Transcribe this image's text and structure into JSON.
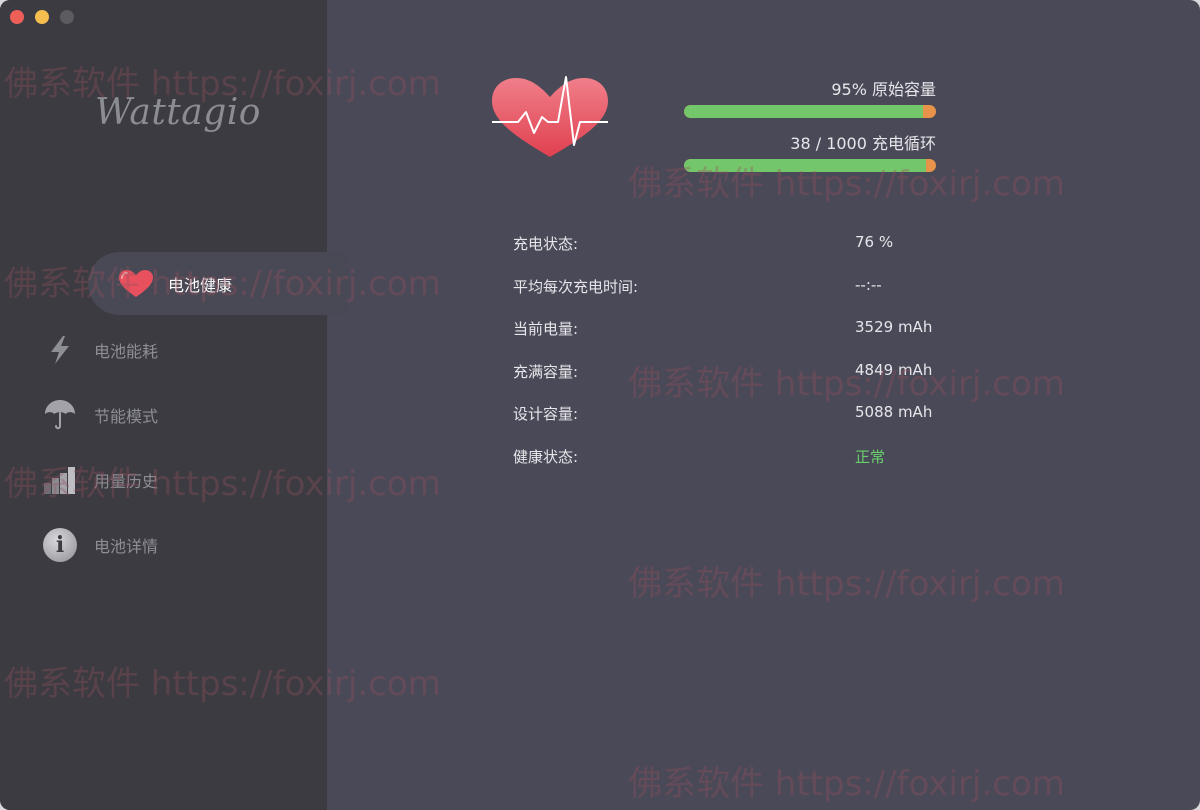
{
  "app": {
    "logo_text": "Wattagio"
  },
  "sidebar": {
    "items": [
      {
        "label": "电池健康",
        "icon": "heart-icon",
        "active": true
      },
      {
        "label": "电池能耗",
        "icon": "lightning-icon",
        "active": false
      },
      {
        "label": "节能模式",
        "icon": "umbrella-icon",
        "active": false
      },
      {
        "label": "用量历史",
        "icon": "bar-chart-icon",
        "active": false
      },
      {
        "label": "电池详情",
        "icon": "info-icon",
        "active": false
      }
    ],
    "info_glyph": "i"
  },
  "health": {
    "capacity_label": "95%  原始容量",
    "capacity_fraction": 0.95,
    "cycles_label": "38 / 1000 充电循环",
    "cycles_fraction": 0.96
  },
  "details": [
    {
      "key": "充电状态:",
      "value": "76 %"
    },
    {
      "key": "平均每次充电时间:",
      "value": "--:--"
    },
    {
      "key": "当前电量:",
      "value": "3529 mAh"
    },
    {
      "key": "充满容量:",
      "value": "4849 mAh"
    },
    {
      "key": "设计容量:",
      "value": "5088 mAh"
    },
    {
      "key": "健康状态:",
      "value": "正常"
    }
  ],
  "watermark": "佛系软件 https://foxirj.com",
  "colors": {
    "accent_green": "#73c66a",
    "accent_orange": "#e7944a",
    "status_ok": "#6ad06b",
    "heart_red": "#e8505e"
  }
}
